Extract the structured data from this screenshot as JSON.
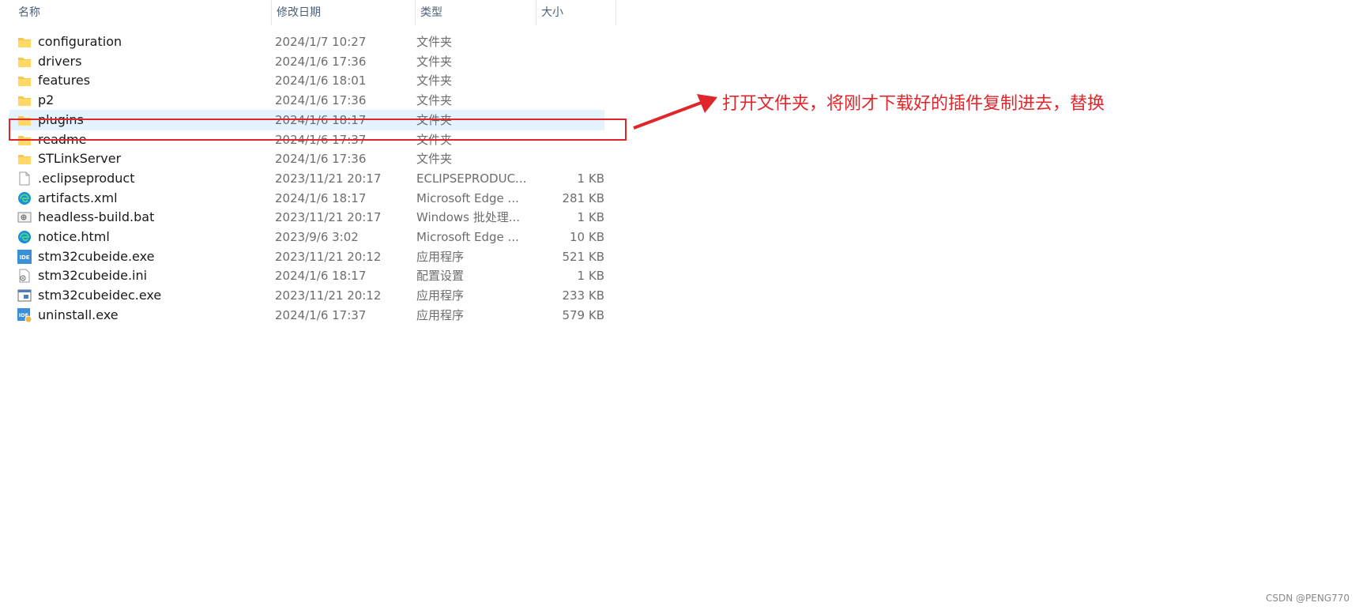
{
  "columns": {
    "name": "名称",
    "date": "修改日期",
    "type": "类型",
    "size": "大小"
  },
  "files": [
    {
      "name": "configuration",
      "date": "2024/1/7 10:27",
      "type": "文件夹",
      "size": "",
      "icon": "folder-icon"
    },
    {
      "name": "drivers",
      "date": "2024/1/6 17:36",
      "type": "文件夹",
      "size": "",
      "icon": "folder-icon"
    },
    {
      "name": "features",
      "date": "2024/1/6 18:01",
      "type": "文件夹",
      "size": "",
      "icon": "folder-icon"
    },
    {
      "name": "p2",
      "date": "2024/1/6 17:36",
      "type": "文件夹",
      "size": "",
      "icon": "folder-icon"
    },
    {
      "name": "plugins",
      "date": "2024/1/6 18:17",
      "type": "文件夹",
      "size": "",
      "icon": "folder-icon",
      "selected": true
    },
    {
      "name": "readme",
      "date": "2024/1/6 17:37",
      "type": "文件夹",
      "size": "",
      "icon": "folder-icon"
    },
    {
      "name": "STLinkServer",
      "date": "2024/1/6 17:36",
      "type": "文件夹",
      "size": "",
      "icon": "folder-icon"
    },
    {
      "name": ".eclipseproduct",
      "date": "2023/11/21 20:17",
      "type": "ECLIPSEPRODUC...",
      "size": "1 KB",
      "icon": "blank-file-icon"
    },
    {
      "name": "artifacts.xml",
      "date": "2024/1/6 18:17",
      "type": "Microsoft Edge ...",
      "size": "281 KB",
      "icon": "edge-icon"
    },
    {
      "name": "headless-build.bat",
      "date": "2023/11/21 20:17",
      "type": "Windows 批处理...",
      "size": "1 KB",
      "icon": "batch-file-icon"
    },
    {
      "name": "notice.html",
      "date": "2023/9/6 3:02",
      "type": "Microsoft Edge ...",
      "size": "10 KB",
      "icon": "edge-icon"
    },
    {
      "name": "stm32cubeide.exe",
      "date": "2023/11/21 20:12",
      "type": "应用程序",
      "size": "521 KB",
      "icon": "ide-app-icon"
    },
    {
      "name": "stm32cubeide.ini",
      "date": "2024/1/6 18:17",
      "type": "配置设置",
      "size": "1 KB",
      "icon": "settings-file-icon"
    },
    {
      "name": "stm32cubeidec.exe",
      "date": "2023/11/21 20:12",
      "type": "应用程序",
      "size": "233 KB",
      "icon": "console-app-icon"
    },
    {
      "name": "uninstall.exe",
      "date": "2024/1/6 17:37",
      "type": "应用程序",
      "size": "579 KB",
      "icon": "ide-uninstall-icon"
    }
  ],
  "annotation": "打开文件夹，将刚才下载好的插件复制进去，替换",
  "watermark": "CSDN @PENG770",
  "colors": {
    "annotation": "#e0262a",
    "selection": "#e5f3ff",
    "folder": "#f5c74a",
    "edge": "#1b8be0",
    "ide": "#3a8fd6"
  }
}
